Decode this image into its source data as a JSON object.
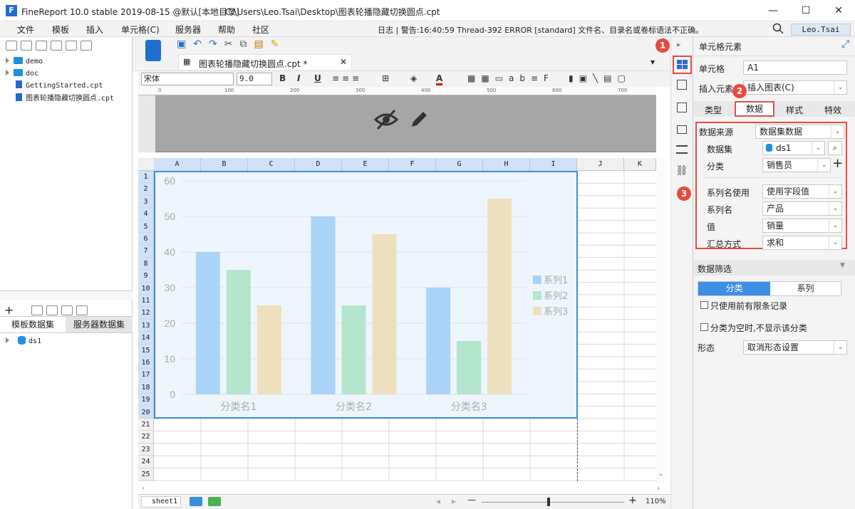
{
  "titlebar": {
    "logo": "F",
    "title": "FineReport 10.0 stable 2019-08-15 @默认[本地目录]",
    "path": "C:\\Users\\Leo.Tsai\\Desktop\\图表轮播隐藏切换圆点.cpt",
    "minimize": "—",
    "maximize": "☐",
    "close": "✕"
  },
  "menu": {
    "items": [
      "文件",
      "模板",
      "插入",
      "单元格(C)",
      "服务器",
      "帮助",
      "社区"
    ],
    "log": "日志 | 警告:16:40:59 Thread-392 ERROR [standard] 文件名、目录名或卷标语法不正确。",
    "user": "Leo.Tsai"
  },
  "left": {
    "tree": [
      {
        "label": "demo",
        "type": "folder"
      },
      {
        "label": "doc",
        "type": "folder"
      },
      {
        "label": "GettingStarted.cpt",
        "type": "file"
      },
      {
        "label": "图表轮播隐藏切换圆点.cpt",
        "type": "file"
      }
    ],
    "ds_tabs": [
      "模板数据集",
      "服务器数据集"
    ],
    "datasets": [
      "ds1"
    ]
  },
  "editor": {
    "tab_label": "图表轮播隐藏切换圆点.cpt *",
    "font_name": "宋体",
    "font_size": "9.0",
    "ruler_ticks": [
      "0",
      "100",
      "200",
      "300",
      "400",
      "500",
      "600",
      "700"
    ],
    "columns": [
      "A",
      "B",
      "C",
      "D",
      "E",
      "F",
      "G",
      "H",
      "I",
      "J",
      "K"
    ],
    "rows": [
      "1",
      "2",
      "3",
      "4",
      "5",
      "6",
      "7",
      "8",
      "9",
      "10",
      "11",
      "12",
      "13",
      "14",
      "15",
      "16",
      "17",
      "18",
      "19",
      "20",
      "21",
      "22",
      "23",
      "24",
      "25"
    ],
    "sheet": "sheet1",
    "zoom": "110%"
  },
  "chart_data": {
    "type": "bar",
    "categories": [
      "分类名1",
      "分类名2",
      "分类名3"
    ],
    "series": [
      {
        "name": "系列1",
        "values": [
          40,
          50,
          30
        ],
        "color": "#a9d4f7"
      },
      {
        "name": "系列2",
        "values": [
          35,
          25,
          15
        ],
        "color": "#b3e6cc"
      },
      {
        "name": "系列3",
        "values": [
          25,
          45,
          55
        ],
        "color": "#eee0bf"
      }
    ],
    "ylim": [
      0,
      60
    ],
    "yticks": [
      "0",
      "10",
      "20",
      "30",
      "40",
      "50",
      "60"
    ],
    "grid": true,
    "legend": "right"
  },
  "panel": {
    "title": "单元格元素",
    "cell_label": "单元格",
    "cell_value": "A1",
    "insert_label": "插入元素",
    "insert_value": "插入图表(C)",
    "tabs": [
      "类型",
      "数据",
      "样式",
      "特效"
    ],
    "datasource_label": "数据来源",
    "datasource_value": "数据集数据",
    "dataset_label": "数据集",
    "dataset_value": "ds1",
    "category_label": "分类",
    "category_value": "销售员",
    "seriesname_use_label": "系列名使用",
    "seriesname_use_value": "使用字段值",
    "seriesname_label": "系列名",
    "seriesname_value": "产品",
    "value_label": "值",
    "value_value": "销量",
    "summary_label": "汇总方式",
    "summary_value": "求和",
    "filter_title": "数据筛选",
    "filter_tabs": [
      "分类",
      "系列"
    ],
    "limit_checkbox": "只使用前有限条记录",
    "empty_checkbox": "分类为空时,不显示该分类",
    "form_label": "形态",
    "form_value": "取消形态设置"
  },
  "badges": [
    "1",
    "2",
    "3"
  ],
  "colors": {
    "accent": "#3c8de0",
    "badge": "#e84a3e",
    "highlight": "#d9534f"
  }
}
